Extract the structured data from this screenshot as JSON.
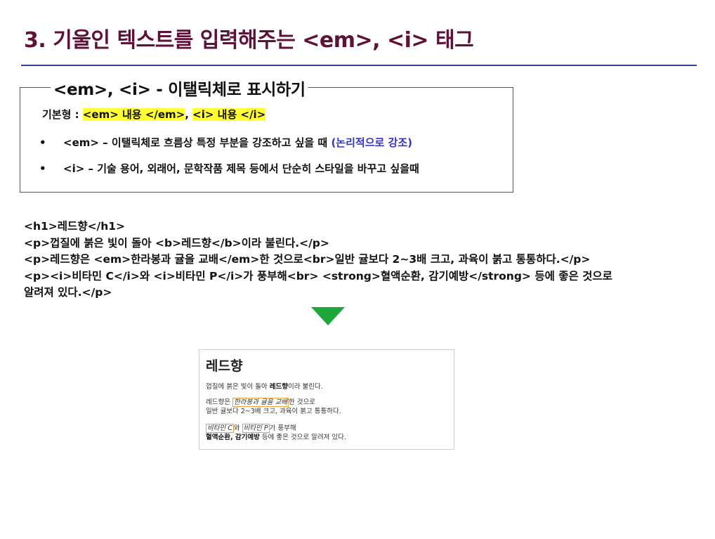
{
  "slide": {
    "title": "3. 기울인 텍스트를 입력해주는 <em>, <i> 태그"
  },
  "box": {
    "heading": "<em>, <i> - 이탤릭체로 표시하기",
    "basic_label": "기본형 : ",
    "basic_em": "<em> 내용 </em>",
    "basic_sep": ", ",
    "basic_i": "<i> 내용 </i>",
    "bullets": [
      {
        "marker": "•",
        "text": "<em> – 이탤릭체로 흐름상 특정 부분을 강조하고 싶을 때 ",
        "note": "(논리적으로 강조)"
      },
      {
        "marker": "•",
        "text": "<i> – 기술 용어, 외래어, 문학작품 제목 등에서 단순히 스타일을 바꾸고 싶을때",
        "note": ""
      }
    ]
  },
  "code_lines": [
    "<h1>레드향</h1>",
    "<p>껍질에 붉은 빛이 돌아 <b>레드향</b>이라 불린다.</p>",
    "<p>레드향은 <em>한라봉과 귤을 교배</em>한 것으로<br>일반 귤보다 2~3배 크고, 과육이 붉고 통통하다.</p>",
    "<p><i>비타민 C</i>와 <i>비타민 P</i>가 풍부해<br> <strong>혈액순환, 감기예방</strong> 등에 좋은 것으로",
    "알려져 있다.</p>"
  ],
  "arrow_color": "#1fa83a",
  "preview": {
    "h1": "레드향",
    "p1_a": "껍질에 붉은 빛이 돌아 ",
    "p1_b": "레드향",
    "p1_c": "이라 불린다.",
    "p2_a": "레드향은 ",
    "p2_em": "한라봉과 귤을 교배",
    "p2_b": "한 것으로",
    "p2_line2": "일반 귤보다 2~3배 크고, 과육이 붉고 통통하다.",
    "p3_i1": "비타민 C",
    "p3_a": "와 ",
    "p3_i2": "비타민 P",
    "p3_b": "가 풍부해",
    "p3_strong": "혈액순환, 감기예방",
    "p3_c": " 등에 좋은 것으로 알려져 있다."
  }
}
